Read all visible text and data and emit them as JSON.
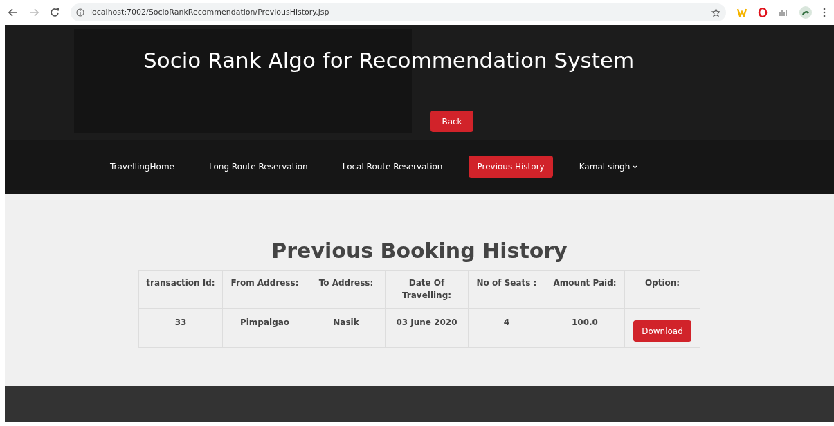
{
  "browser": {
    "url": "localhost:7002/SocioRankRecommendation/PreviousHistory.jsp"
  },
  "header": {
    "title": "Socio Rank Algo for Recommendation System",
    "back_button": "Back"
  },
  "nav": [
    {
      "label": "TravellingHome",
      "selected": false
    },
    {
      "label": "Long Route Reservation",
      "selected": false
    },
    {
      "label": "Local Route Reservation",
      "selected": false
    },
    {
      "label": "Previous History",
      "selected": true
    },
    {
      "label": "Kamal singh",
      "selected": false,
      "dropdown": true
    }
  ],
  "heading": "Previous Booking History",
  "table": {
    "columns": [
      "transaction Id:",
      "From Address:",
      "To Address:",
      "Date Of Travelling:",
      "No of Seats :",
      "Amount Paid:",
      "Option:"
    ],
    "rows": [
      {
        "cells": [
          "33",
          "Pimpalgao",
          "Nasik",
          "03 June 2020",
          "4",
          "100.0"
        ],
        "action": "Download"
      }
    ]
  }
}
